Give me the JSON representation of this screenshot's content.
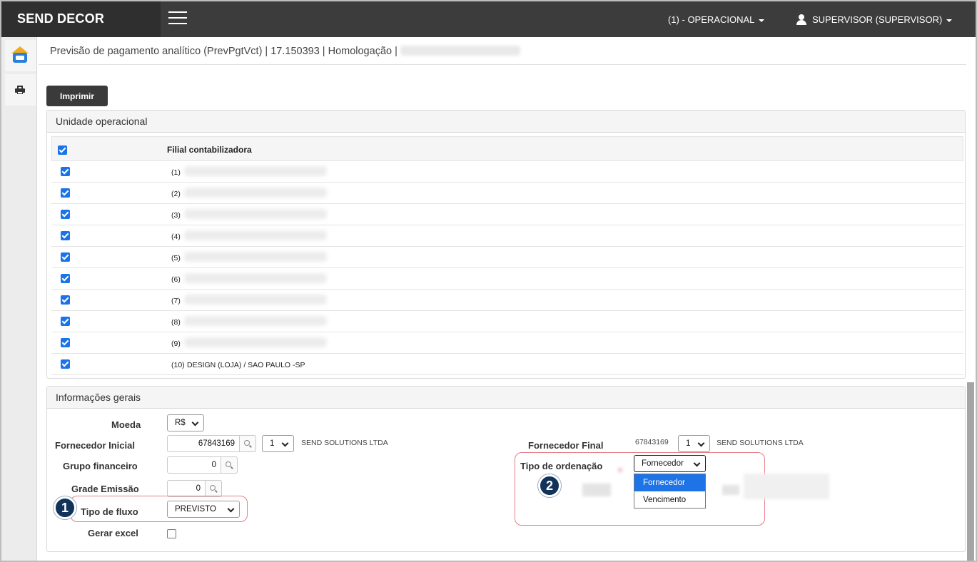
{
  "app": {
    "brand": "SEND DECOR",
    "company_menu": "(1) - OPERACIONAL",
    "user_menu": "SUPERVISOR (SUPERVISOR)"
  },
  "breadcrumb": "Previsão de pagamento analítico (PrevPgtVct) | 17.150393 | Homologação |",
  "toolbar": {
    "print_label": "Imprimir"
  },
  "unidade": {
    "title": "Unidade operacional",
    "column_header": "Filial contabilizadora",
    "rows": [
      {
        "num": "(1)",
        "name": ""
      },
      {
        "num": "(2)",
        "name": ""
      },
      {
        "num": "(3)",
        "name": ""
      },
      {
        "num": "(4)",
        "name": ""
      },
      {
        "num": "(5)",
        "name": ""
      },
      {
        "num": "(6)",
        "name": ""
      },
      {
        "num": "(7)",
        "name": ""
      },
      {
        "num": "(8)",
        "name": ""
      },
      {
        "num": "(9)",
        "name": ""
      },
      {
        "num": "(10)",
        "name": "DESIGN (LOJA) / SAO PAULO -SP"
      }
    ]
  },
  "info": {
    "title": "Informações gerais",
    "moeda_label": "Moeda",
    "moeda_value": "R$",
    "fornecedor_inicial_label": "Fornecedor Inicial",
    "fornecedor_inicial_value": "67843169",
    "fornecedor_inicial_seq": "1",
    "fornecedor_inicial_name": "SEND SOLUTIONS LTDA",
    "grupo_label": "Grupo financeiro",
    "grupo_value": "0",
    "grade_label": "Grade Emissão",
    "grade_value": "0",
    "tipo_fluxo_label": "Tipo de fluxo",
    "tipo_fluxo_value": "PREVISTO",
    "gerar_excel_label": "Gerar excel",
    "fornecedor_final_label": "Fornecedor Final",
    "fornecedor_final_value": "67843169",
    "fornecedor_final_seq": "1",
    "fornecedor_final_name": "SEND SOLUTIONS LTDA",
    "ordenacao_label": "Tipo de ordenação",
    "ordenacao_value": "Fornecedor",
    "ordenacao_options": [
      "Fornecedor",
      "Vencimento"
    ]
  },
  "badges": {
    "one": "1",
    "two": "2"
  },
  "colors": {
    "navbar": "#3c3c3c",
    "accent": "#1e73e6",
    "badge": "#11335a",
    "highlight": "#e57f89"
  }
}
